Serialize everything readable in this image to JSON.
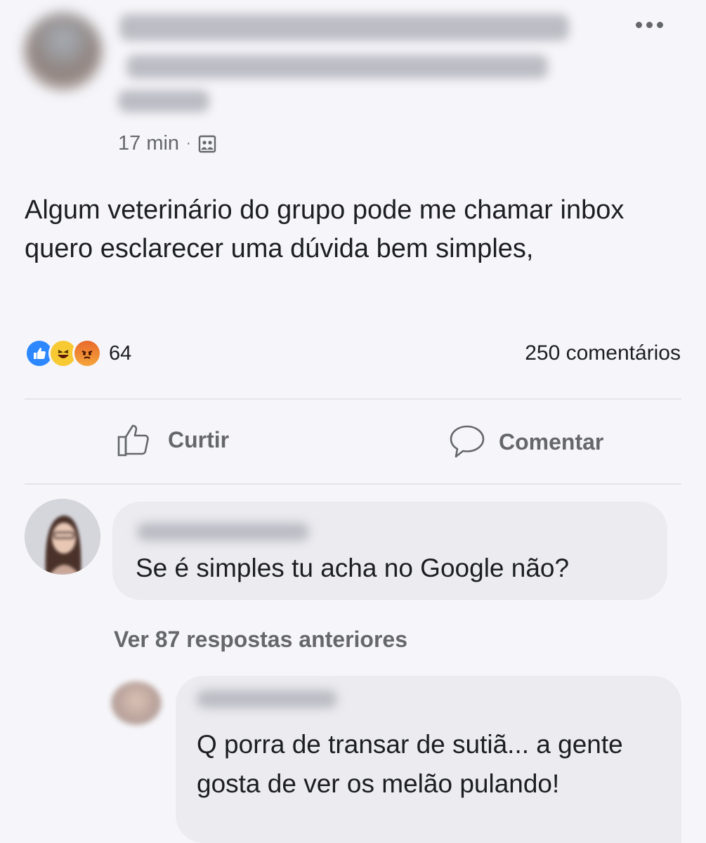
{
  "post": {
    "time": "17 min",
    "separator": "·",
    "audience_icon": "group-icon",
    "text": "Algum veterinário do grupo pode me chamar inbox quero esclarecer uma dúvida bem simples,",
    "reactions": {
      "types": [
        "like-icon",
        "haha-icon",
        "angry-icon"
      ],
      "count": "64"
    },
    "comments_count": "250 comentários"
  },
  "actions": {
    "like_label": "Curtir",
    "comment_label": "Comentar"
  },
  "comments": [
    {
      "text": "Se é simples tu acha no Google não?"
    }
  ],
  "replies_link": "Ver 87 respostas anteriores",
  "replies": [
    {
      "text": "Q porra de transar de sutiã... a gente gosta de ver os melão pulando!"
    }
  ],
  "colors": {
    "background": "#f6f6fa",
    "secondary_text": "#65676b",
    "like_blue": "#2d88ff",
    "bubble": "#ebebf0"
  }
}
